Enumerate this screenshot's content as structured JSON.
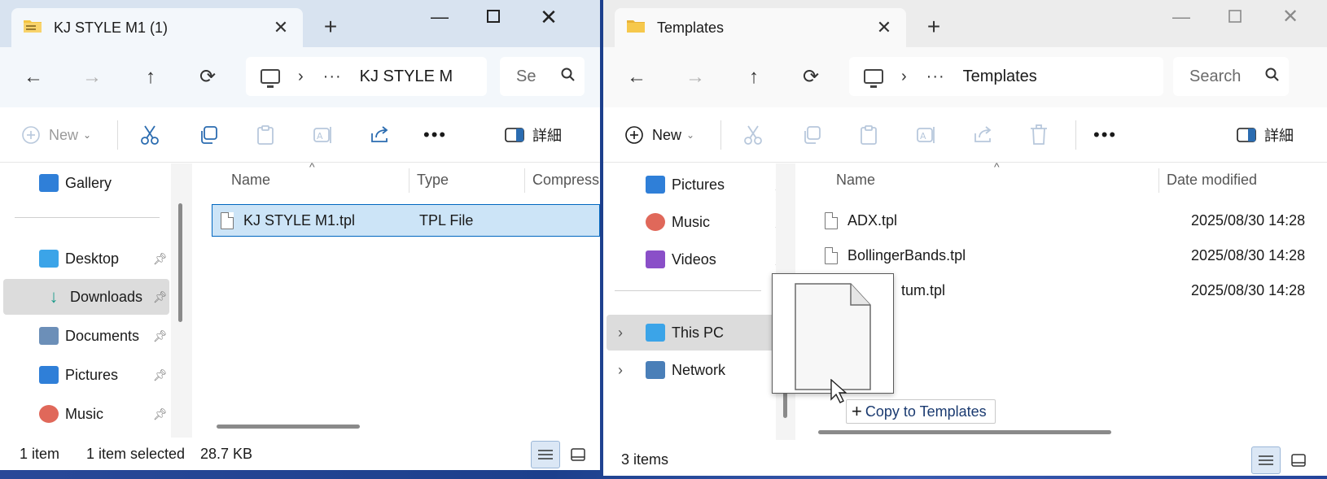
{
  "left_window": {
    "tab_title": "KJ STYLE M1 (1)",
    "address_path": "KJ STYLE M",
    "search_placeholder": "Se",
    "toolbar": {
      "new_label": "New",
      "details_label": "詳細"
    },
    "sidebar": [
      {
        "label": "Gallery",
        "icon": "gallery-icon",
        "pinned": false
      },
      {
        "label": "Desktop",
        "icon": "desktop-folder-icon",
        "pinned": true
      },
      {
        "label": "Downloads",
        "icon": "downloads-icon",
        "pinned": true,
        "selected": true
      },
      {
        "label": "Documents",
        "icon": "documents-icon",
        "pinned": true
      },
      {
        "label": "Pictures",
        "icon": "pictures-icon",
        "pinned": true
      },
      {
        "label": "Music",
        "icon": "music-icon",
        "pinned": true
      }
    ],
    "columns": [
      "Name",
      "Type",
      "Compress"
    ],
    "files": [
      {
        "name": "KJ STYLE M1.tpl",
        "type": "TPL File",
        "selected": true
      }
    ],
    "status": {
      "count": "1 item",
      "selection": "1 item selected",
      "size": "28.7 KB"
    }
  },
  "right_window": {
    "tab_title": "Templates",
    "address_path": "Templates",
    "search_placeholder": "Search",
    "toolbar": {
      "new_label": "New",
      "details_label": "詳細"
    },
    "sidebar": [
      {
        "label": "Pictures",
        "icon": "pictures-icon",
        "pinned": true
      },
      {
        "label": "Music",
        "icon": "music-icon",
        "pinned": true
      },
      {
        "label": "Videos",
        "icon": "videos-icon",
        "pinned": true
      },
      {
        "label": "This PC",
        "icon": "this-pc-icon",
        "expandable": true,
        "selected": true
      },
      {
        "label": "Network",
        "icon": "network-icon",
        "expandable": true
      }
    ],
    "columns": [
      "Name",
      "Date modified"
    ],
    "files": [
      {
        "name": "ADX.tpl",
        "date": "2025/08/30 14:28"
      },
      {
        "name": "BollingerBands.tpl",
        "date": "2025/08/30 14:28"
      },
      {
        "name": "tum.tpl",
        "date": "2025/08/30 14:28"
      }
    ],
    "status": {
      "count": "3 items"
    }
  },
  "drag": {
    "tooltip": "Copy to Templates"
  },
  "colors": {
    "accent": "#2b6cb0",
    "selection_bg": "#cce4f7",
    "selection_border": "#0067c0",
    "desktop_bg": "#24449a"
  }
}
